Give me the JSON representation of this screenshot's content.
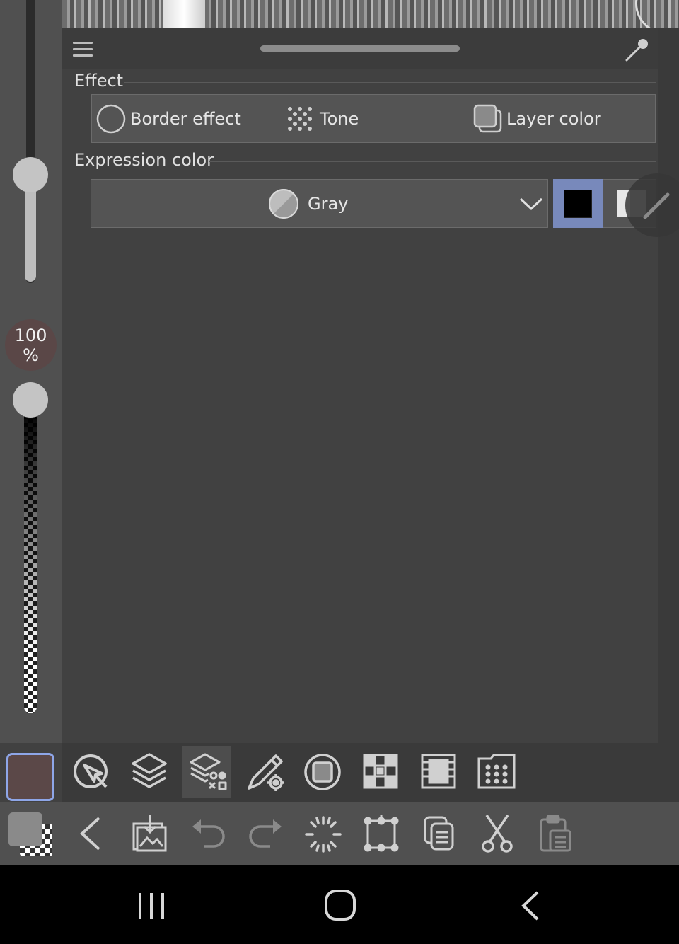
{
  "brush": {
    "opacity_percent": "100",
    "opacity_unit": "%"
  },
  "panel": {
    "effect_section": {
      "title": "Effect",
      "options": [
        {
          "label": "Border effect",
          "icon": "circle-outline-icon"
        },
        {
          "label": "Tone",
          "icon": "tone-dots-icon"
        },
        {
          "label": "Layer color",
          "icon": "layer-color-icon"
        }
      ]
    },
    "expression_section": {
      "title": "Expression color",
      "selected": "Gray",
      "selected_icon": "gray-circle-icon",
      "swatches": [
        {
          "name": "black",
          "color": "#000000",
          "selected": true
        },
        {
          "name": "white-gray",
          "color": "#d0d0d0",
          "selected": false
        }
      ]
    }
  },
  "colors": {
    "main_color": "#5b4848",
    "selection_accent": "#7889bb",
    "percent_badge": "#5a4747"
  },
  "toolbar": {
    "tools": [
      "tool-property-icon",
      "layer-icon",
      "layer-property-icon",
      "brush-settings-icon",
      "navigator-icon",
      "material-icon",
      "animation-icon",
      "timeline-icon"
    ],
    "commands": [
      "back-icon",
      "import-image-icon",
      "undo-icon",
      "redo-icon",
      "selection-icon",
      "transform-icon",
      "copy-icon",
      "cut-icon",
      "paste-icon"
    ]
  },
  "navigation": [
    "recent-apps-icon",
    "home-icon",
    "back-icon"
  ]
}
